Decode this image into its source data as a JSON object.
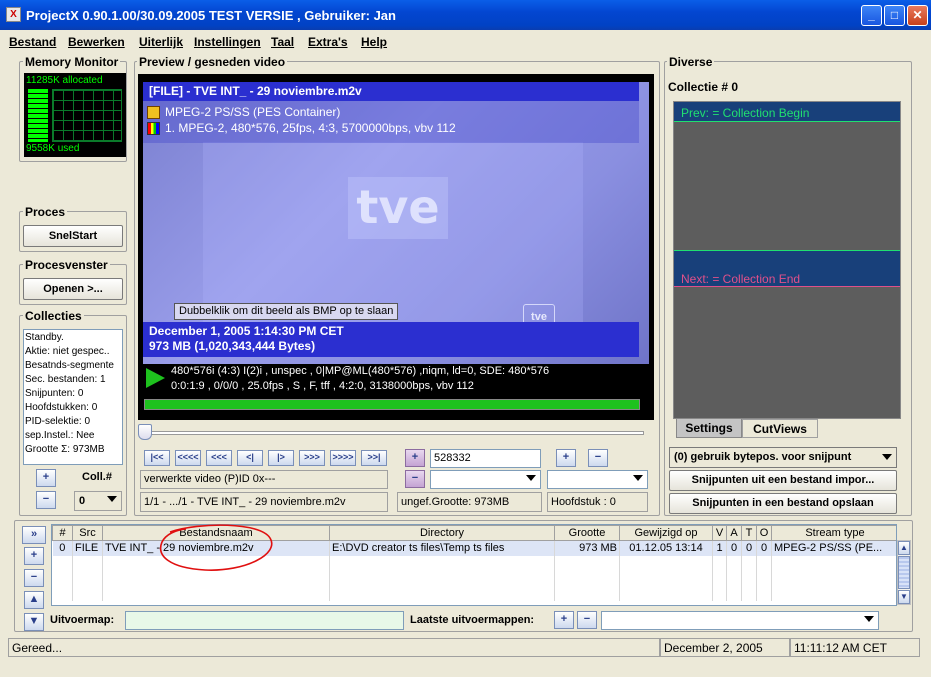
{
  "window": {
    "title": "ProjectX 0.90.1.00/30.09.2005 TEST VERSIE , Gebruiker: Jan",
    "app_icon_glyph": "X"
  },
  "menu": [
    "Bestand",
    "Bewerken",
    "Uiterlijk",
    "Instellingen",
    "Taal",
    "Extra's",
    "Help"
  ],
  "memory": {
    "title": "Memory Monitor",
    "allocated": "11285K allocated",
    "used": "9558K used"
  },
  "proces": {
    "title": "Proces",
    "button": "SnelStart"
  },
  "procesvenster": {
    "title": "Procesvenster",
    "button": "Openen >..."
  },
  "collecties": {
    "title": "Collecties",
    "lines": [
      "Standby.",
      "Aktie: niet gespec..",
      "Besatnds-segmente",
      "Sec. bestanden: 1",
      "Snijpunten: 0",
      "Hoofdstukken: 0",
      "PID-selektie: 0",
      "sep.Instel.: Nee",
      "Grootte Σ: 973MB"
    ],
    "coll_label": "Coll.#",
    "coll_value": "0"
  },
  "preview": {
    "title": "Preview / gesneden video",
    "file_header": "[FILE] - TVE INT_ - 29 noviembre.m2v",
    "container": "MPEG-2 PS/SS (PES Container)",
    "stream": "1.  MPEG-2, 480*576, 25fps, 4:3, 5700000bps, vbv 112",
    "logo": "tve",
    "tooltip": "Dubbelklik om dit beeld als BMP op te slaan",
    "date": "December 1, 2005  1:14:30 PM CET",
    "size": "973 MB (1,020,343,444 Bytes)",
    "info1": "480*576i (4:3) I(2)i , unspec , 0|MP@ML(480*576)  ,niqm, ld=0, SDE: 480*576",
    "info2": "0:0:1:9 , 0/0/0 , 25.0fps , S , F, tff , 4:2:0, 3138000bps, vbv 112",
    "progress": 1.0
  },
  "nav": {
    "buttons": [
      "|<<",
      "<<<<",
      "<<<",
      "<|",
      "|>",
      ">>>",
      ">>>>",
      ">>|"
    ],
    "pid_text": "verwerkte video (P)ID 0x---",
    "file_pos": "1/1 - .../1 - TVE INT_ - 29 noviembre.m2v",
    "offset_value": "528332",
    "ungef_grootte": "ungef.Grootte: 973MB",
    "hoofdstuk": "Hoofdstuk :  0"
  },
  "diverse": {
    "title": "Diverse",
    "collectie": "Collectie # 0",
    "prev": "Prev: = Collection Begin",
    "next": "Next: = Collection End",
    "tabs": [
      "Settings",
      "CutViews"
    ],
    "cut_option": "(0) gebruik bytepos. voor snijpunt",
    "import_button": "Snijpunten uit een bestand impor...",
    "save_button": "Snijpunten in een bestand opslaan",
    "colors": {
      "prev": "#20e070",
      "next": "#e0508a"
    }
  },
  "table": {
    "headers": [
      "#",
      "Src",
      "Bestandsnaam",
      "Directory",
      "Grootte",
      "Gewijzigd op",
      "V",
      "A",
      "T",
      "O",
      "Stream type"
    ],
    "rows": [
      [
        "0",
        "FILE",
        "TVE INT_ - 29 noviembre.m2v",
        "E:\\DVD creator ts files\\Temp ts files",
        "973 MB",
        "01.12.05  13:14",
        "1",
        "0",
        "0",
        "0",
        "MPEG-2 PS/SS (PE..."
      ]
    ]
  },
  "output": {
    "label": "Uitvoermap:",
    "value": "",
    "last_label": "Laatste uitvoermappen:"
  },
  "status": {
    "text": "Gereed...",
    "date": "December 2, 2005",
    "time": "11:11:12 AM CET"
  }
}
